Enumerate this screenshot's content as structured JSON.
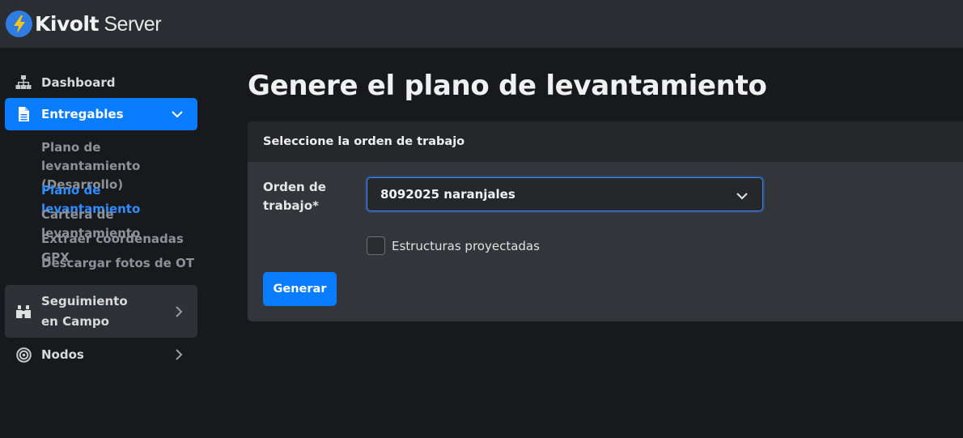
{
  "app": {
    "brand_bold": "Kivolt",
    "brand_regular": " Server",
    "accent_color": "#0a7cff",
    "logo_icon": "lightning-bolt-icon"
  },
  "sidebar": {
    "items": [
      {
        "label": "Dashboard",
        "icon": "sitemap-icon"
      },
      {
        "label": "Entregables",
        "icon": "document-icon",
        "expanded": true
      },
      {
        "label": "Seguimiento en Campo",
        "icon": "binoculars-icon"
      },
      {
        "label": "Nodos",
        "icon": "target-icon"
      }
    ],
    "subitems": [
      {
        "label": "Plano de levantamiento (Desarrollo)"
      },
      {
        "label": "Plano de levantamiento",
        "active": true
      },
      {
        "label": "Cartera de levantamiento"
      },
      {
        "label": "Extraer coordenadas GPX"
      },
      {
        "label": "Descargar fotos de OT"
      }
    ]
  },
  "main": {
    "title": "Genere el plano de levantamiento",
    "card": {
      "header": "Seleccione la orden de trabajo",
      "field_label": "Orden de trabajo*",
      "selected_value": "8092025 naranjales",
      "checkbox_label": "Estructuras proyectadas",
      "checkbox_checked": false,
      "button_label": "Generar"
    }
  }
}
